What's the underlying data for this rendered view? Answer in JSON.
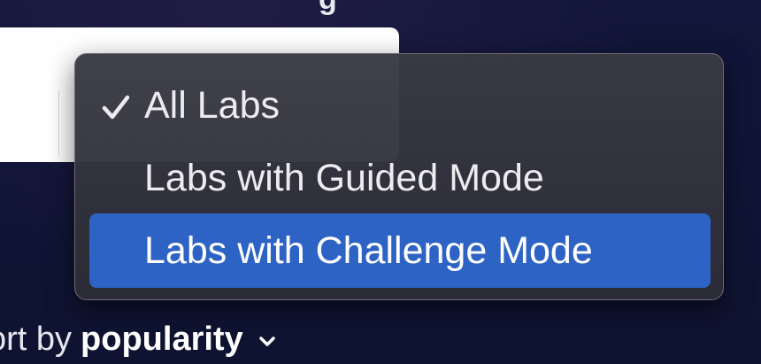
{
  "header": {
    "partial_text": "g"
  },
  "dropdown": {
    "items": [
      {
        "label": "All Labs",
        "selected": true,
        "highlighted": false
      },
      {
        "label": "Labs with Guided Mode",
        "selected": false,
        "highlighted": false
      },
      {
        "label": "Labs with Challenge Mode",
        "selected": false,
        "highlighted": true
      }
    ],
    "check_icon": "checkmark-icon",
    "highlight_color": "#2d63c4"
  },
  "sort": {
    "label": "ort by",
    "value": "popularity",
    "icon": "chevron-down-icon"
  },
  "colors": {
    "background": "#0f1433",
    "menu_background": "#3a3a44",
    "text": "#ececf0"
  }
}
